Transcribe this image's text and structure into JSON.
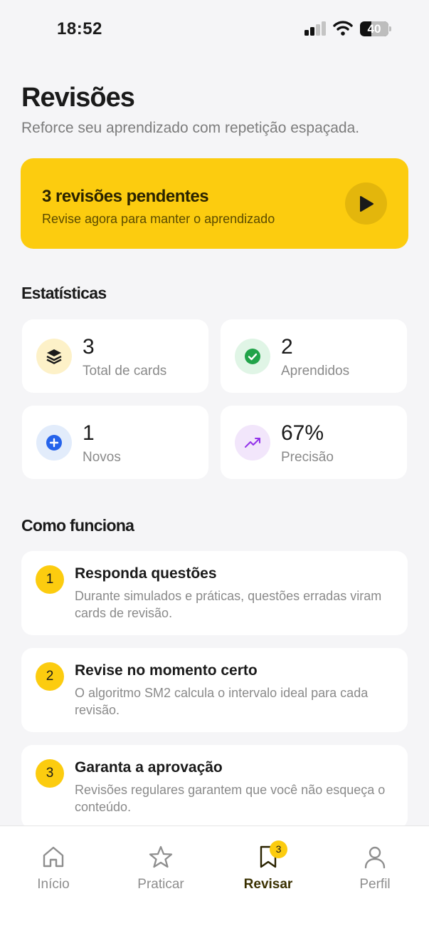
{
  "status_bar": {
    "time": "18:52",
    "battery": "40"
  },
  "header": {
    "title": "Revisões",
    "subtitle": "Reforce seu aprendizado com repetição espaçada."
  },
  "banner": {
    "title": "3 revisões pendentes",
    "subtitle": "Revise agora para manter o aprendizado",
    "play_icon": "play-icon",
    "color": "#fccc0f"
  },
  "stats": {
    "title": "Estatísticas",
    "items": [
      {
        "value": "3",
        "label": "Total de cards",
        "icon": "layers-icon",
        "icon_bg": "#fdf1c8",
        "icon_color": "#1a1a1a"
      },
      {
        "value": "2",
        "label": "Aprendidos",
        "icon": "check-circle-icon",
        "icon_bg": "#e0f5e6",
        "icon_color": "#22a34a"
      },
      {
        "value": "1",
        "label": "Novos",
        "icon": "plus-circle-icon",
        "icon_bg": "#e2ecfb",
        "icon_color": "#2563eb"
      },
      {
        "value": "67%",
        "label": "Precisão",
        "icon": "trending-up-icon",
        "icon_bg": "#f2e6fb",
        "icon_color": "#9333ea"
      }
    ]
  },
  "how_it_works": {
    "title": "Como funciona",
    "steps": [
      {
        "number": "1",
        "title": "Responda questões",
        "description": "Durante simulados e práticas, questões erradas viram cards de revisão."
      },
      {
        "number": "2",
        "title": "Revise no momento certo",
        "description": "O algoritmo SM2 calcula o intervalo ideal para cada revisão."
      },
      {
        "number": "3",
        "title": "Garanta a aprovação",
        "description": "Revisões regulares garantem que você não esqueça o conteúdo."
      }
    ]
  },
  "nav": {
    "items": [
      {
        "label": "Início",
        "icon": "home-icon",
        "active": false
      },
      {
        "label": "Praticar",
        "icon": "star-icon",
        "active": false
      },
      {
        "label": "Revisar",
        "icon": "bookmark-icon",
        "active": true,
        "badge": "3"
      },
      {
        "label": "Perfil",
        "icon": "user-icon",
        "active": false
      }
    ]
  }
}
